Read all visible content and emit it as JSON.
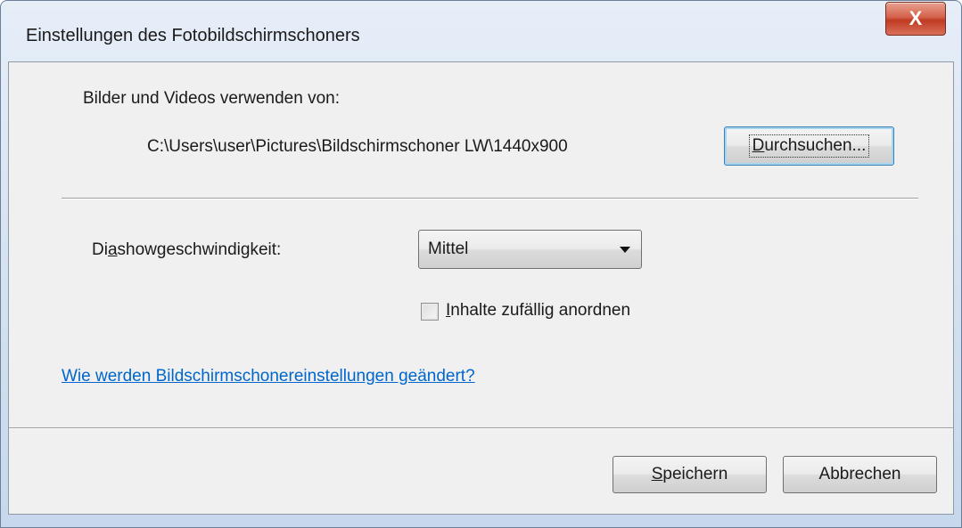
{
  "window": {
    "title": "Einstellungen des Fotobildschirmschoners",
    "close_glyph": "X"
  },
  "source": {
    "label": "Bilder und Videos verwenden von:",
    "path": "C:\\Users\\user\\Pictures\\Bildschirmschoner LW\\1440x900",
    "browse_button": {
      "accel": "D",
      "rest": "urchsuchen..."
    }
  },
  "speed": {
    "label_pre": "Di",
    "label_accel": "a",
    "label_post": "showgeschwindigkeit:",
    "selected": "Mittel"
  },
  "shuffle": {
    "checked": false,
    "label_accel": "I",
    "label_rest": "nhalte zufällig anordnen"
  },
  "help_link": "Wie werden Bildschirmschonereinstellungen geändert?",
  "footer": {
    "save": {
      "accel": "S",
      "rest": "peichern"
    },
    "cancel": "Abbrechen"
  },
  "icons": {
    "close": "close-icon",
    "dropdown": "chevron-down-icon"
  }
}
